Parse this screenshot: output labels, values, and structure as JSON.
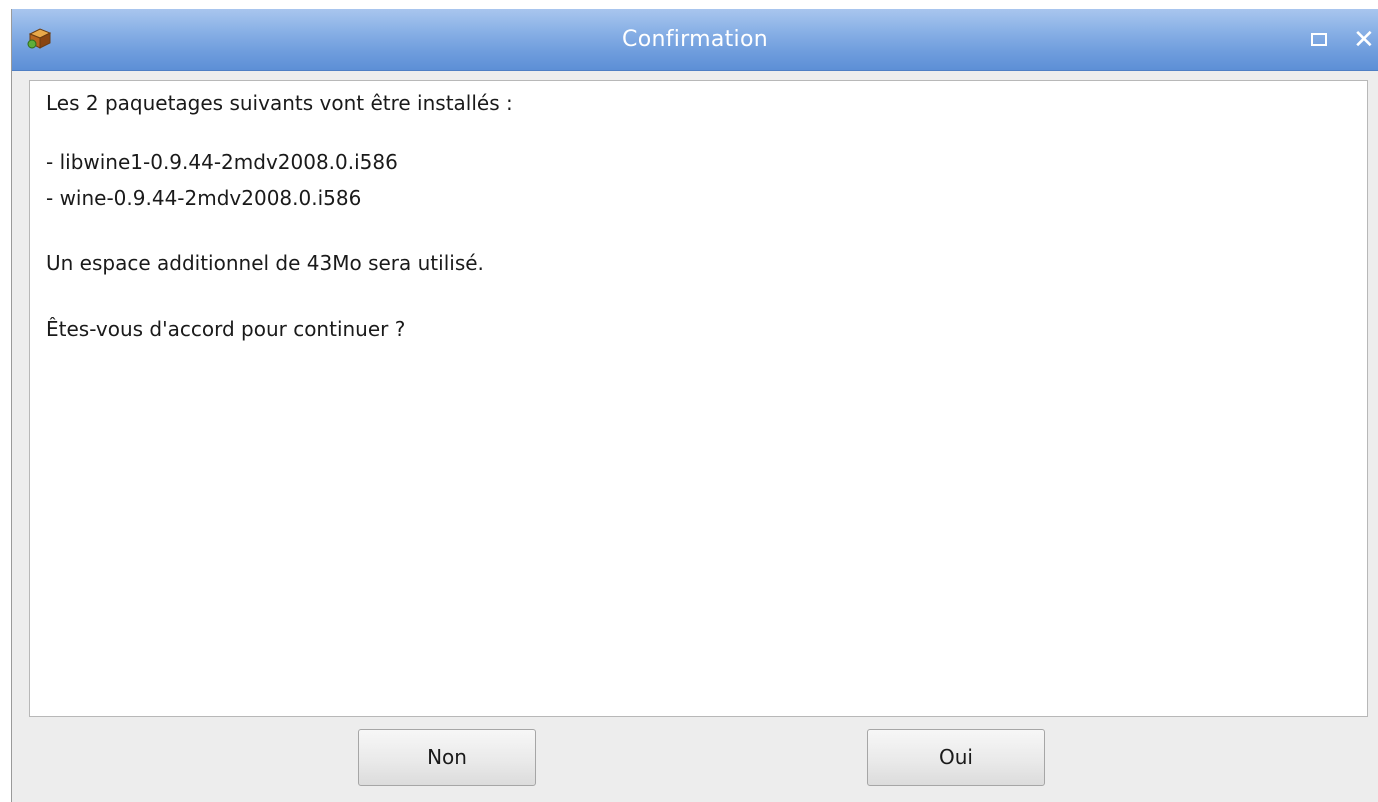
{
  "window": {
    "title": "Confirmation",
    "icon": "package-box-icon",
    "maximize_icon": "maximize-icon",
    "close_label": "✕"
  },
  "message": {
    "line1": "Les 2 paquetages suivants vont être installés :",
    "packages": [
      "- libwine1-0.9.44-2mdv2008.0.i586",
      "- wine-0.9.44-2mdv2008.0.i586"
    ],
    "space": "Un espace additionnel de 43Mo sera utilisé.",
    "question": "Êtes-vous d'accord pour continuer ?"
  },
  "buttons": {
    "no_label": "Non",
    "yes_label": "Oui"
  },
  "colors": {
    "titlebar": "#6f9ddd",
    "background": "#ededed"
  }
}
